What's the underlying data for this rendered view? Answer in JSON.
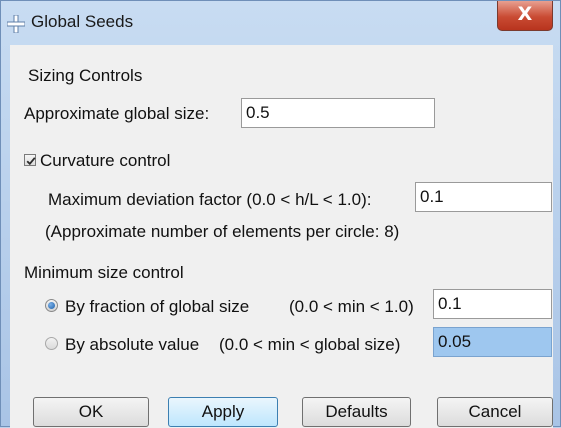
{
  "window": {
    "title": "Global Seeds",
    "close_symbol": "X",
    "app_icon": "cross-icon"
  },
  "sizing": {
    "section_label": "Sizing Controls",
    "global_size_label": "Approximate global size:",
    "global_size_value": "0.5"
  },
  "curvature": {
    "checkbox_label": "Curvature control",
    "checked": true,
    "deviation_label": "Maximum deviation factor (0.0 < h/L < 1.0):",
    "deviation_value": "0.1",
    "elements_note": "(Approximate number of elements per circle: 8)"
  },
  "min_size": {
    "section_label": "Minimum size control",
    "fraction_label": "By fraction of global size",
    "fraction_range": "(0.0 < min < 1.0)",
    "fraction_value": "0.1",
    "fraction_selected": true,
    "absolute_label": "By absolute value",
    "absolute_range": "(0.0 < min < global size)",
    "absolute_value": "0.05",
    "absolute_selected": false
  },
  "buttons": {
    "ok": "OK",
    "apply": "Apply",
    "defaults": "Defaults",
    "cancel": "Cancel"
  },
  "colors": {
    "title_bar": "#b9d1ee",
    "close_button": "#c94b33",
    "selected_field": "#9ec7ef"
  }
}
